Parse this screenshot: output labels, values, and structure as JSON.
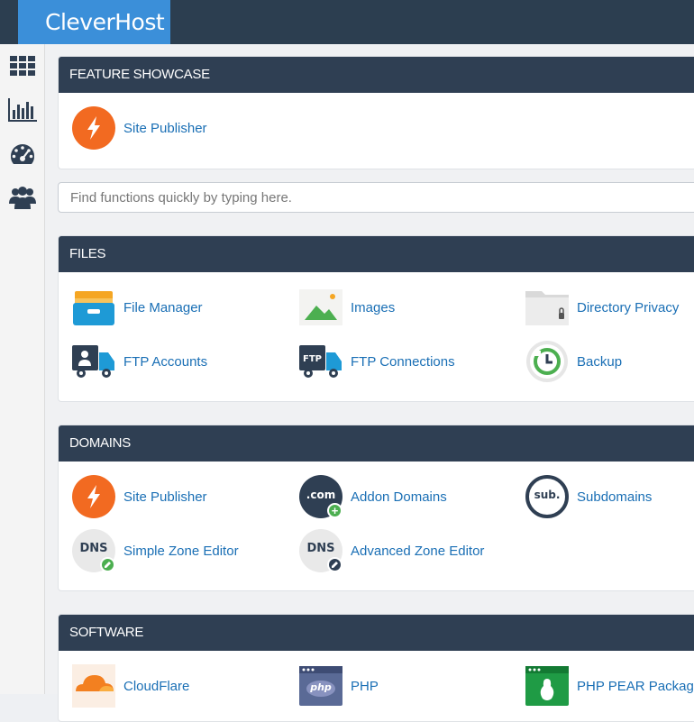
{
  "brand": {
    "name": "CleverHost"
  },
  "sidebar": {
    "items": [
      {
        "icon": "grid-icon"
      },
      {
        "icon": "bar-chart-icon"
      },
      {
        "icon": "dashboard-gauge-icon"
      },
      {
        "icon": "users-icon"
      }
    ]
  },
  "search": {
    "placeholder": "Find functions quickly by typing here."
  },
  "sections": {
    "feature": {
      "title": "FEATURE SHOWCASE",
      "items": [
        {
          "label": "Site Publisher",
          "icon": "lightning-icon"
        }
      ]
    },
    "files": {
      "title": "FILES",
      "items": [
        {
          "label": "File Manager",
          "icon": "file-drawer-icon"
        },
        {
          "label": "Images",
          "icon": "image-icon"
        },
        {
          "label": "Directory Privacy",
          "icon": "folder-lock-icon"
        },
        {
          "label": "FTP Accounts",
          "icon": "ftp-truck-user-icon"
        },
        {
          "label": "FTP Connections",
          "icon": "ftp-truck-icon"
        },
        {
          "label": "Backup",
          "icon": "backup-clock-icon"
        }
      ]
    },
    "domains": {
      "title": "DOMAINS",
      "items": [
        {
          "label": "Site Publisher",
          "icon": "lightning-icon"
        },
        {
          "label": "Addon Domains",
          "icon": "dotcom-icon",
          "icon_text": ".com"
        },
        {
          "label": "Subdomains",
          "icon": "sub-icon",
          "icon_text": "sub."
        },
        {
          "label": "Simple Zone Editor",
          "icon": "dns-edit-icon",
          "icon_text": "DNS"
        },
        {
          "label": "Advanced Zone Editor",
          "icon": "dns-advanced-icon",
          "icon_text": "DNS"
        }
      ]
    },
    "software": {
      "title": "SOFTWARE",
      "items": [
        {
          "label": "CloudFlare",
          "icon": "cloudflare-icon"
        },
        {
          "label": "PHP",
          "icon": "php-icon",
          "icon_text": "php"
        },
        {
          "label": "PHP PEAR Packages",
          "icon": "pear-icon"
        }
      ]
    }
  },
  "colors": {
    "header": "#2c3e50",
    "brand": "#3b8fd9",
    "panel_header": "#2f3f53",
    "link": "#1a6fb5",
    "orange": "#f26a21"
  }
}
